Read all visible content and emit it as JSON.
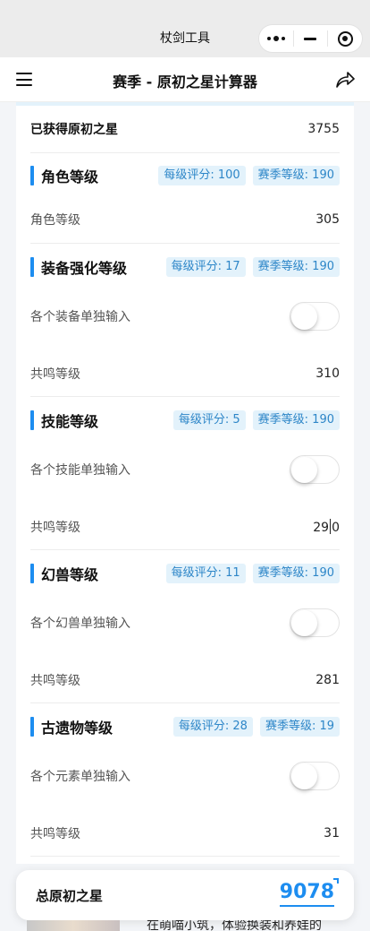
{
  "system_bar": {
    "title": "杖剑工具"
  },
  "navbar": {
    "title": "赛季 - 原初之星计算器"
  },
  "obtained": {
    "label": "已获得原初之星",
    "value": "3755"
  },
  "sections": {
    "character": {
      "title": "角色等级",
      "per_level": "每级评分: 100",
      "season_level": "赛季等级: 190",
      "level_label": "角色等级",
      "level_value": "305"
    },
    "equipment": {
      "title": "装备强化等级",
      "per_level": "每级评分: 17",
      "season_level": "赛季等级: 190",
      "toggle_label": "各个装备单独输入",
      "toggle_on": false,
      "resonance_label": "共鸣等级",
      "resonance_value": "310"
    },
    "skill": {
      "title": "技能等级",
      "per_level": "每级评分: 5",
      "season_level": "赛季等级: 190",
      "toggle_label": "各个技能单独输入",
      "toggle_on": false,
      "resonance_label": "共鸣等级",
      "resonance_value_a": "29",
      "resonance_value_b": "0"
    },
    "phantom": {
      "title": "幻兽等级",
      "per_level": "每级评分: 11",
      "season_level": "赛季等级: 190",
      "toggle_label": "各个幻兽单独输入",
      "toggle_on": false,
      "resonance_label": "共鸣等级",
      "resonance_value": "281"
    },
    "relic": {
      "title": "古遗物等级",
      "per_level": "每级评分: 28",
      "season_level": "赛季等级: 19",
      "toggle_label": "各个元素单独输入",
      "toggle_on": false,
      "resonance_label": "共鸣等级",
      "resonance_value": "31"
    }
  },
  "total": {
    "label": "总原初之星",
    "value": "9078"
  },
  "ad": {
    "text": "在萌喵小筑，体验换装和养娃的"
  },
  "colors": {
    "accent": "#1d8df0",
    "tag_bg": "#e3f2fb",
    "tag_text": "#2d86c8"
  }
}
